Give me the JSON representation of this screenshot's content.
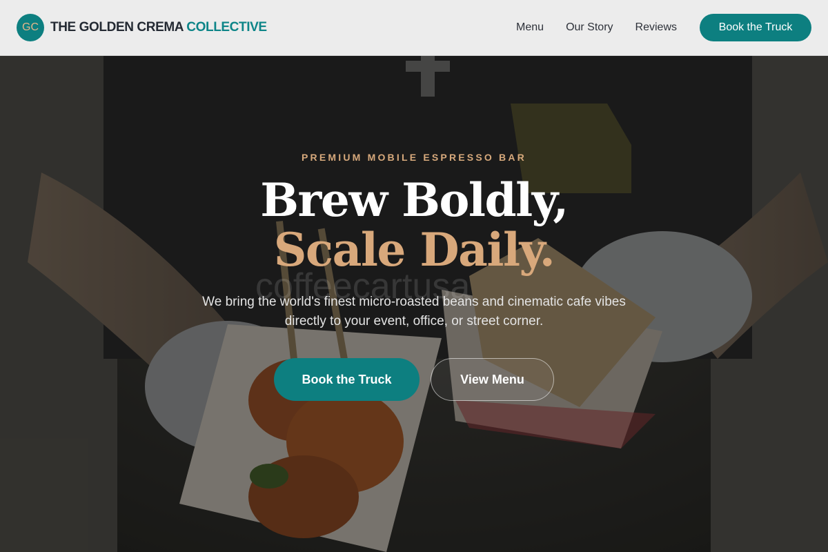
{
  "nav": {
    "logo_initials": "GC",
    "brand_primary": "THE GOLDEN CREMA",
    "brand_accent": "COLLECTIVE",
    "links": [
      "Menu",
      "Our Story",
      "Reviews"
    ],
    "cta_label": "Book the Truck"
  },
  "hero": {
    "eyebrow": "PREMIUM MOBILE ESPRESSO BAR",
    "headline_line1": "Brew Boldly,",
    "headline_line2": "Scale Daily.",
    "subtitle": "We bring the world's finest micro-roasted beans and cinematic cafe vibes directly to your event, office, or street corner.",
    "primary_button": "Book the Truck",
    "secondary_button": "View Menu",
    "watermark": "coffeecartusa"
  },
  "colors": {
    "brand_teal": "#0d7f80",
    "accent_gold": "#d8a87b",
    "nav_background": "#ececec"
  }
}
